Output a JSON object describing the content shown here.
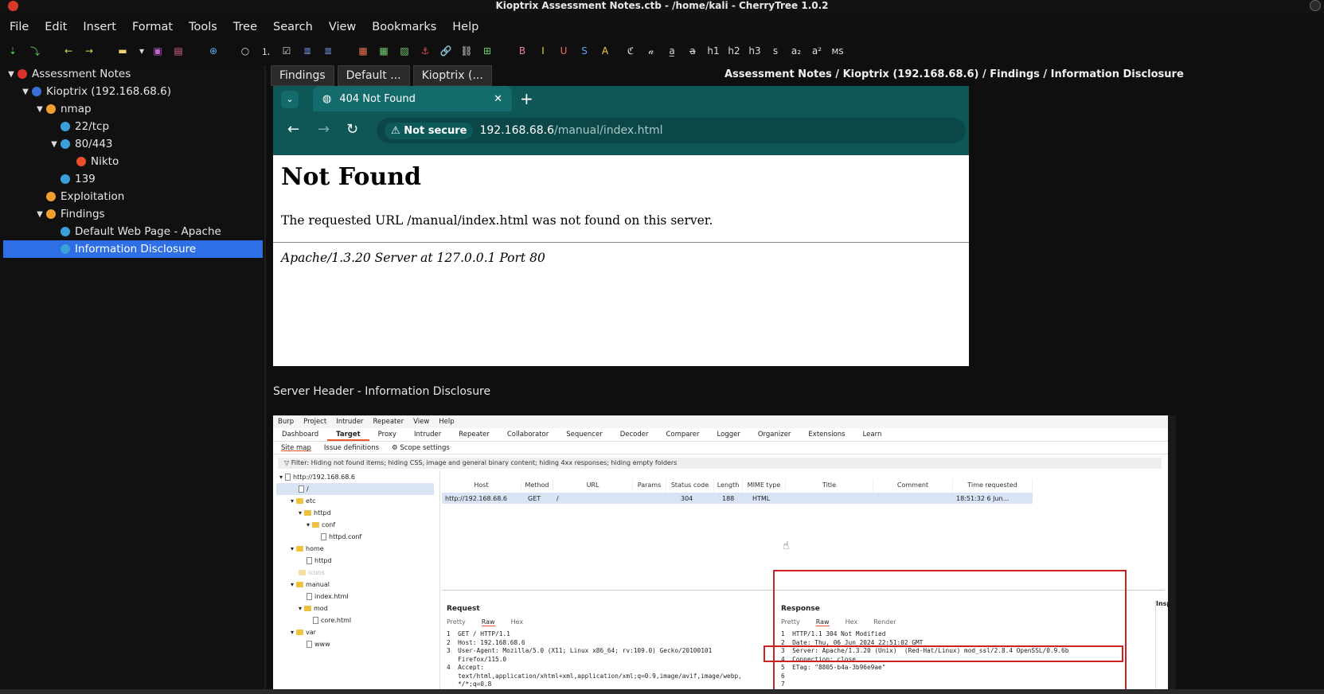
{
  "window": {
    "title": "Kioptrix Assessment Notes.ctb - /home/kali - CherryTree 1.0.2"
  },
  "menubar": [
    "File",
    "Edit",
    "Insert",
    "Format",
    "Tools",
    "Tree",
    "Search",
    "View",
    "Bookmarks",
    "Help"
  ],
  "tree": [
    {
      "label": "Assessment Notes",
      "color": "#d8332a"
    },
    {
      "label": "Kioptrix (192.168.68.6)",
      "color": "#3a6fd8"
    },
    {
      "label": "nmap",
      "color": "#f0a030"
    },
    {
      "label": "22/tcp",
      "color": "#3aa0d8"
    },
    {
      "label": "80/443",
      "color": "#3aa0d8"
    },
    {
      "label": "Nikto",
      "color": "#e8502a"
    },
    {
      "label": "139",
      "color": "#3aa0d8"
    },
    {
      "label": "Exploitation",
      "color": "#f0a030"
    },
    {
      "label": "Findings",
      "color": "#f0a030"
    },
    {
      "label": "Default Web Page - Apache",
      "color": "#3aa0d8"
    },
    {
      "label": "Information Disclosure",
      "color": "#3aa0d8"
    }
  ],
  "tabs": [
    "Findings",
    "Default ...",
    "Kioptrix (..."
  ],
  "breadcrumb": "Assessment Notes / Kioptrix (192.168.68.6) / Findings / Information Disclosure",
  "browser": {
    "tab_title": "404 Not Found",
    "not_secure": "Not secure",
    "url_host": "192.168.68.6",
    "url_path": "/manual/index.html",
    "heading": "Not Found",
    "message": "The requested URL /manual/index.html was not found on this server.",
    "server_sig": "Apache/1.3.20 Server at 127.0.0.1 Port 80"
  },
  "caption": "Server Header - Information Disclosure",
  "burp": {
    "menu": [
      "Burp",
      "Project",
      "Intruder",
      "Repeater",
      "View",
      "Help"
    ],
    "tabs": [
      "Dashboard",
      "Target",
      "Proxy",
      "Intruder",
      "Repeater",
      "Collaborator",
      "Sequencer",
      "Decoder",
      "Comparer",
      "Logger",
      "Organizer",
      "Extensions",
      "Learn"
    ],
    "subtabs": [
      "Site map",
      "Issue definitions",
      "Scope settings"
    ],
    "filter": "Filter: Hiding not found items; hiding CSS, image and general binary content; hiding 4xx responses; hiding empty folders",
    "tree": [
      "http://192.168.68.6",
      "/",
      "etc",
      "httpd",
      "conf",
      "httpd.conf",
      "home",
      "httpd",
      "icons",
      "manual",
      "index.html",
      "mod",
      "core.html",
      "var",
      "www"
    ],
    "columns": [
      "Host",
      "Method",
      "URL",
      "Params",
      "Status code",
      "Length",
      "MIME type",
      "Title",
      "Comment",
      "Time requested"
    ],
    "row": [
      "http://192.168.68.6",
      "GET",
      "/",
      "",
      "304",
      "188",
      "HTML",
      "",
      "",
      "18:51:32 6 Jun..."
    ],
    "request_title": "Request",
    "response_title": "Response",
    "req_tabs": [
      "Pretty",
      "Raw",
      "Hex"
    ],
    "res_tabs": [
      "Pretty",
      "Raw",
      "Hex",
      "Render"
    ],
    "request_lines": "1  GET / HTTP/1.1\n2  Host: 192.168.68.6\n3  User-Agent: Mozilla/5.0 (X11; Linux x86_64; rv:109.0) Gecko/20100101\n   Firefox/115.0\n4  Accept:\n   text/html,application/xhtml+xml,application/xml;q=0.9,image/avif,image/webp,\n   */*;q=0.8",
    "response_lines": "1  HTTP/1.1 304 Not Modified\n2  Date: Thu, 06 Jun 2024 22:51:02 GMT\n3  Server: Apache/1.3.20 (Unix)  (Red-Hat/Linux) mod_ssl/2.8.4 OpenSSL/0.9.6b\n4  Connection: close\n5  ETag: \"8805-b4a-3b96e9ae\"\n6\n7",
    "inspector": "Insp"
  }
}
